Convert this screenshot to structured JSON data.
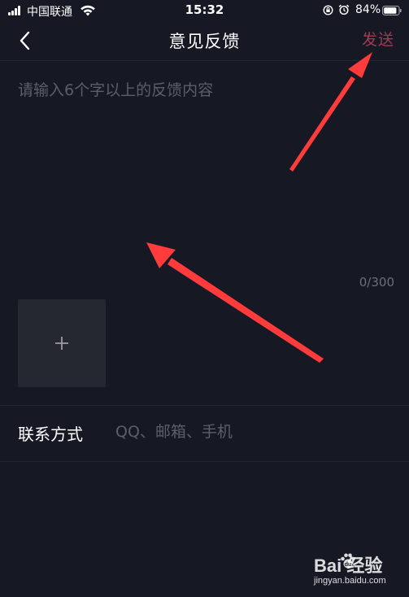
{
  "status_bar": {
    "carrier": "中国联通",
    "time": "15:32",
    "battery": "84%"
  },
  "nav": {
    "title": "意见反馈",
    "send_label": "发送",
    "send_color": "#a6394f"
  },
  "feedback": {
    "placeholder": "请输入6个字以上的反馈内容",
    "value": "",
    "char_count": "0/300"
  },
  "add_image": {
    "icon": "plus-icon"
  },
  "contact": {
    "label": "联系方式",
    "placeholder": "QQ、邮箱、手机",
    "value": ""
  },
  "watermark": {
    "brand": "Bai  经验",
    "url": "jingyan.baidu.com"
  },
  "colors": {
    "background": "#161823",
    "annotation_arrow": "#ff3b3b",
    "tile": "#252731"
  }
}
